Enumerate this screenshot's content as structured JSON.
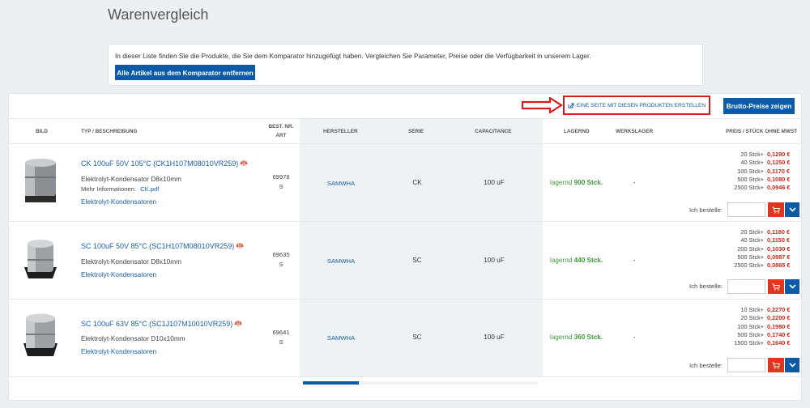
{
  "page": {
    "title": "Warenvergleich"
  },
  "info": {
    "text": "In dieser Liste finden Sie die Produkte, die Sie dem Komparator hinzugefügt haben. Vergleichen Sie Parameter, Preise oder die Verfügbarkeit in unserem Lager.",
    "remove_all_label": "Alle Artikel aus dem Komparator entfernen"
  },
  "toolbar": {
    "create_page_label": "EINE SEITE MIT DIESEN PRODUKTEN ERSTELLEN",
    "brutto_label": "Brutto-Preise zeigen"
  },
  "columns": {
    "image": "BILD",
    "type": "TYP / BESCHREIBUNG",
    "partno_1": "BEST. NR.",
    "partno_2": "ART",
    "maker": "HERSTELLER",
    "series": "SERIE",
    "capacitance": "CAPACITANCE",
    "stock": "LAGERND",
    "factory": "WERKSLAGER",
    "price": "PREIS / STÜCK OHNE MWST"
  },
  "products": [
    {
      "title": "CK 100uF 50V 105°C (CK1H107M08010VR259)",
      "description": "Elektrolyt-Kondensator D8x10mm",
      "more_label": "Mehr Informationen:",
      "more_link": "CK.pdf",
      "category": "Elektrolyt-Kondensatoren",
      "partno_line1": "69978",
      "partno_line2": "S",
      "maker": "SAMWHA",
      "series": "CK",
      "capacitance": "100 uF",
      "stock_prefix": "lagernd",
      "stock_qty": "900 Stck.",
      "factory": "-",
      "prices": [
        {
          "qty": "20 Stck+",
          "price": "0,1290 €"
        },
        {
          "qty": "40 Stck+",
          "price": "0,1250 €"
        },
        {
          "qty": "100 Stck+",
          "price": "0,1170 €"
        },
        {
          "qty": "500 Stck+",
          "price": "0,1080 €"
        },
        {
          "qty": "2500 Stck+",
          "price": "0,0946 €"
        }
      ],
      "order_label": "Ich bestelle:",
      "qty_value": ""
    },
    {
      "title": "SC 100uF 50V 85°C (SC1H107M08010VR259)",
      "description": "Elektrolyt-Kondensator D8x10mm",
      "category": "Elektrolyt-Kondensatoren",
      "partno_line1": "69635",
      "partno_line2": "S",
      "maker": "SAMWHA",
      "series": "SC",
      "capacitance": "100 uF",
      "stock_prefix": "lagernd",
      "stock_qty": "440 Stck.",
      "factory": "-",
      "prices": [
        {
          "qty": "20 Stck+",
          "price": "0,1180 €"
        },
        {
          "qty": "40 Stck+",
          "price": "0,1150 €"
        },
        {
          "qty": "200 Stck+",
          "price": "0,1030 €"
        },
        {
          "qty": "500 Stck+",
          "price": "0,0987 €"
        },
        {
          "qty": "2500 Stck+",
          "price": "0,0865 €"
        }
      ],
      "order_label": "Ich bestelle:",
      "qty_value": ""
    },
    {
      "title": "SC 100uF 63V 85°C (SC1J107M10010VR259)",
      "description": "Elektrolyt-Kondensator D10x10mm",
      "category": "Elektrolyt-Kondensatoren",
      "partno_line1": "69641",
      "partno_line2": "S",
      "maker": "SAMWHA",
      "series": "SC",
      "capacitance": "100 uF",
      "stock_prefix": "lagernd",
      "stock_qty": "360 Stck.",
      "factory": "-",
      "prices": [
        {
          "qty": "10 Stck+",
          "price": "0,2270 €"
        },
        {
          "qty": "20 Stck+",
          "price": "0,2200 €"
        },
        {
          "qty": "100 Stck+",
          "price": "0,1980 €"
        },
        {
          "qty": "500 Stck+",
          "price": "0,1740 €"
        },
        {
          "qty": "1500 Stck+",
          "price": "0,1640 €"
        }
      ],
      "order_label": "Ich bestelle:",
      "qty_value": ""
    }
  ],
  "colors": {
    "accent": "#0d5aa7",
    "price_red": "#c8291a",
    "stock_green": "#3e9a37",
    "highlight_red": "#d11e1e"
  }
}
